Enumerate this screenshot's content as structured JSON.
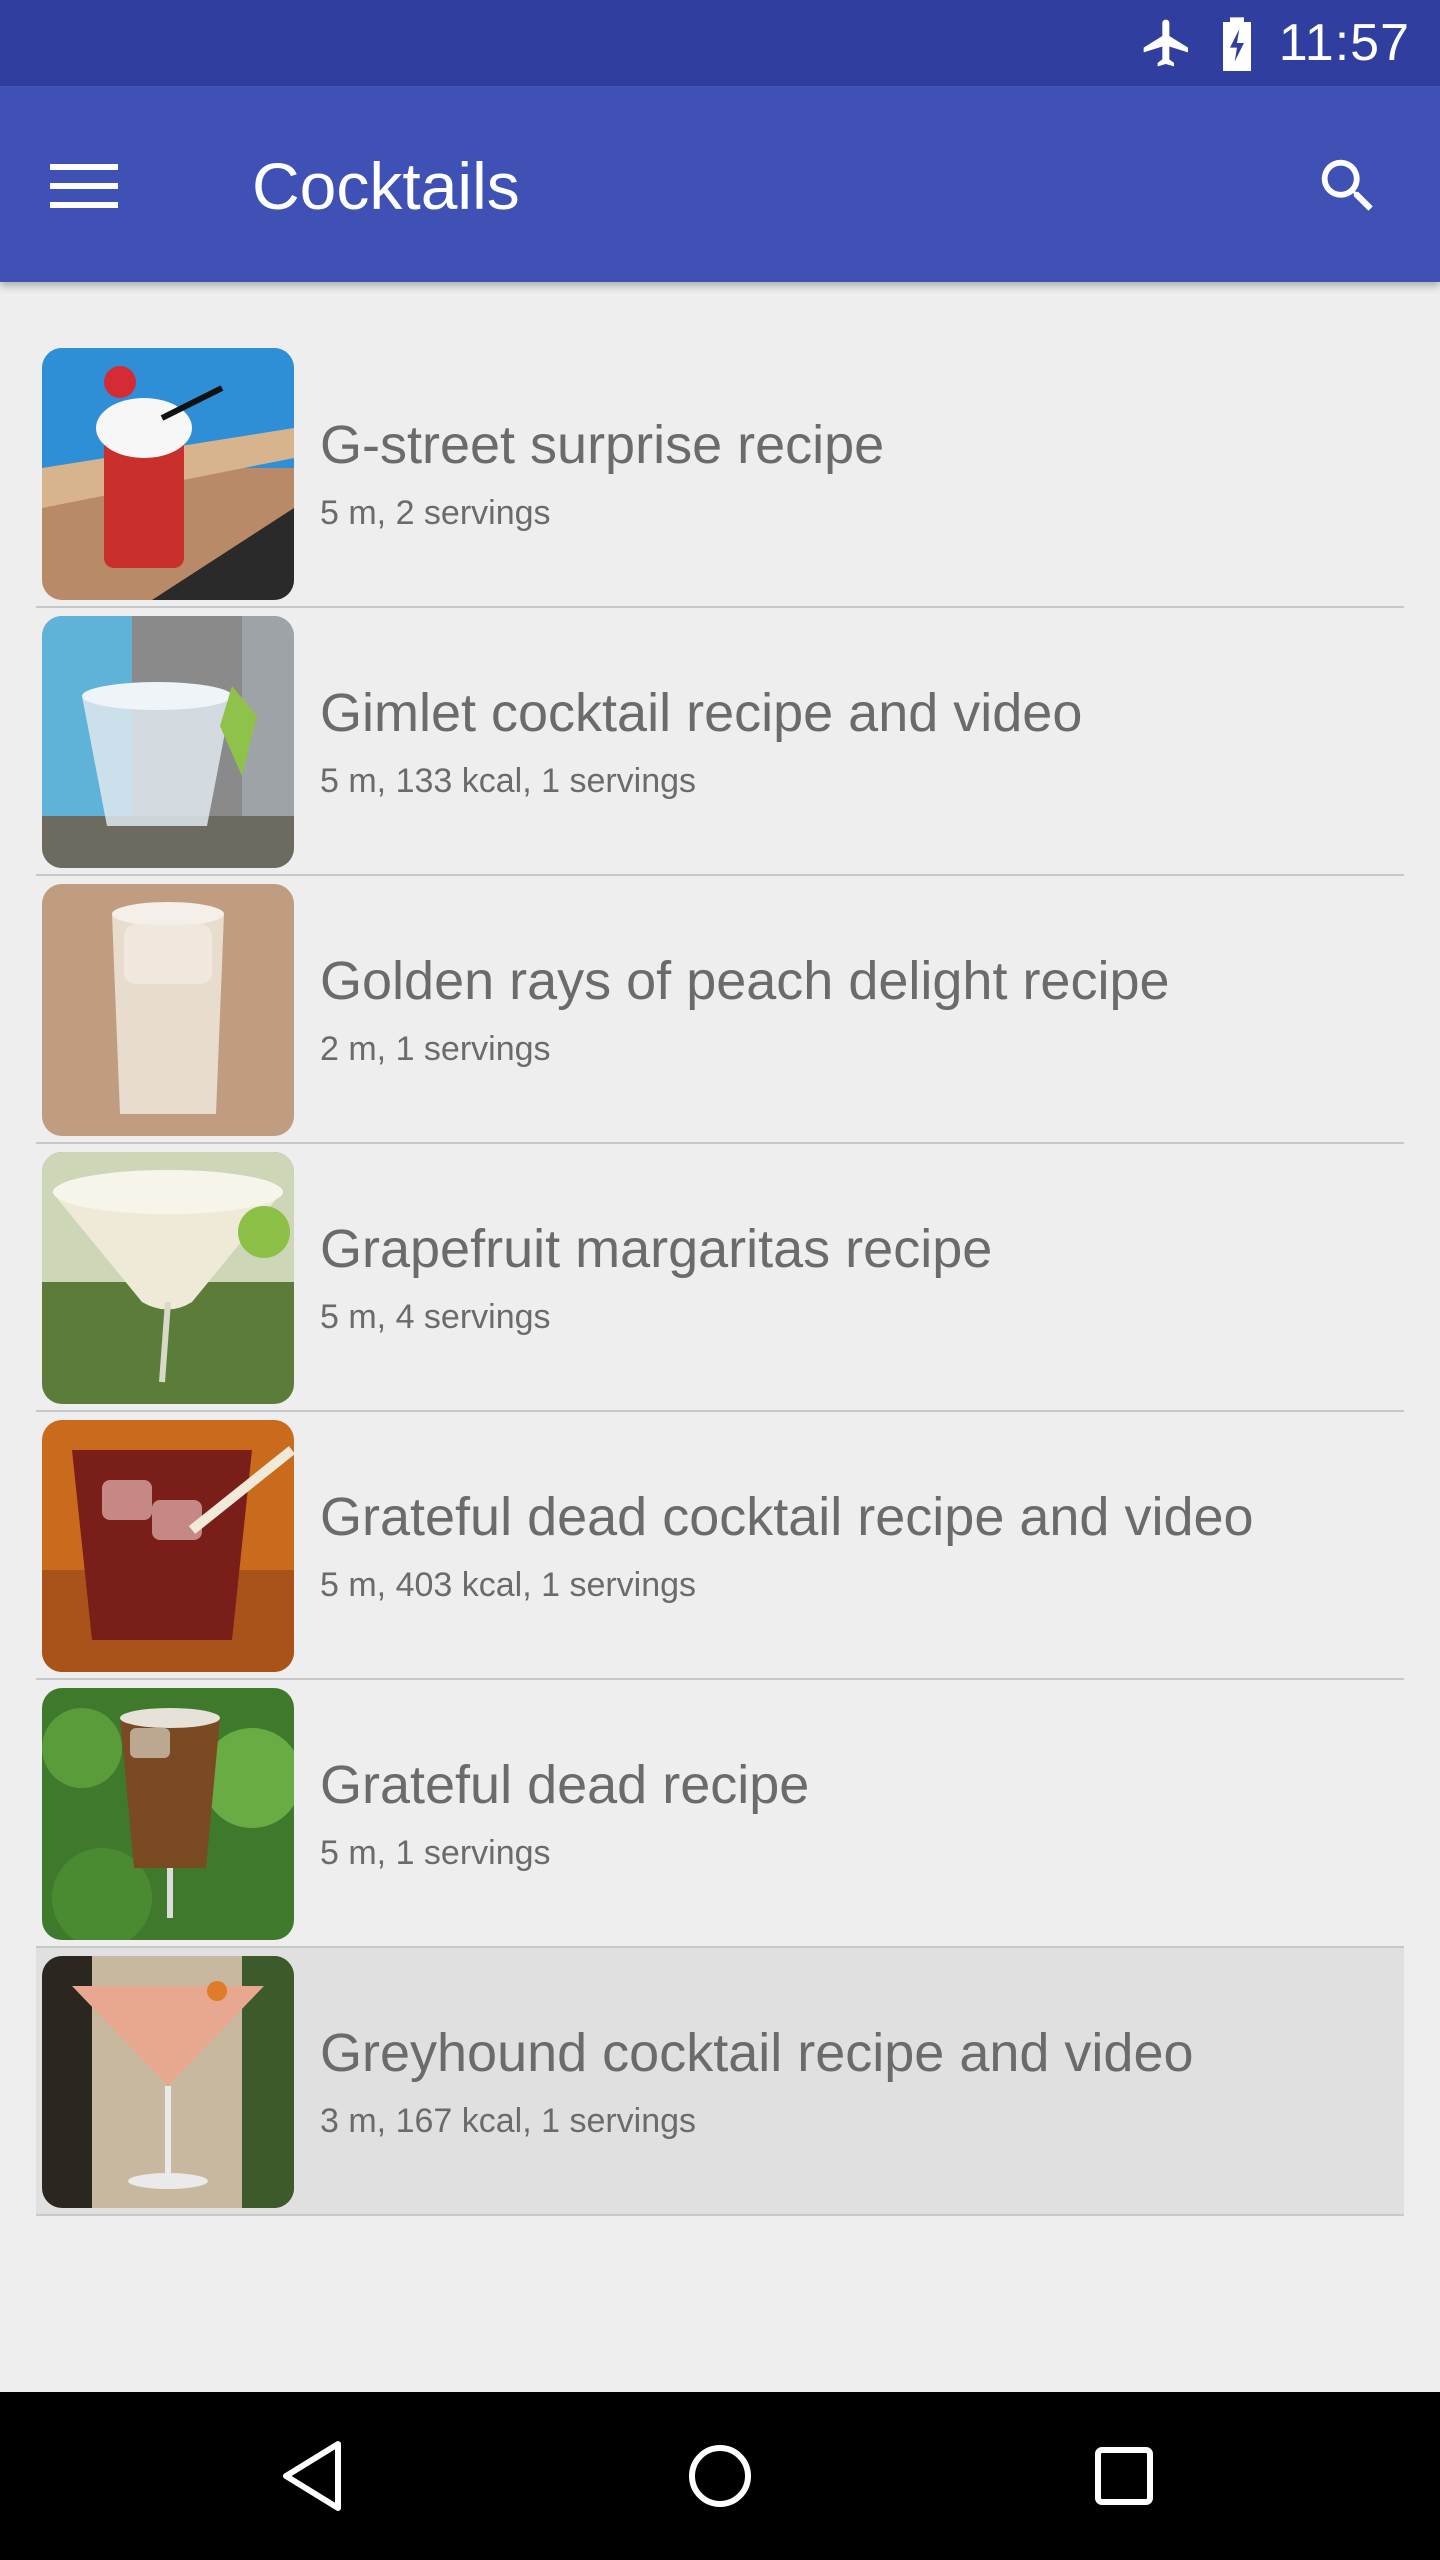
{
  "status_bar": {
    "time": "11:57",
    "icons": [
      "airplane-icon",
      "battery-charging-icon"
    ]
  },
  "app_bar": {
    "title": "Cocktails",
    "menu_icon": "hamburger-menu-icon",
    "search_icon": "search-icon",
    "color": "#3f51b5"
  },
  "recipes": [
    {
      "title": "G-street surprise recipe",
      "meta": "5 m, 2 servings"
    },
    {
      "title": "Gimlet cocktail recipe and video",
      "meta": "5 m, 133 kcal, 1 servings"
    },
    {
      "title": "Golden rays of peach delight recipe",
      "meta": "2 m, 1 servings"
    },
    {
      "title": "Grapefruit margaritas recipe",
      "meta": "5 m, 4 servings"
    },
    {
      "title": "Grateful dead cocktail recipe and video",
      "meta": "5 m, 403 kcal, 1 servings"
    },
    {
      "title": "Grateful dead recipe",
      "meta": "5 m, 1 servings"
    },
    {
      "title": "Greyhound cocktail recipe and video",
      "meta": "3 m, 167 kcal, 1 servings"
    }
  ],
  "nav_bar": {
    "icons": [
      "back-icon",
      "home-icon",
      "recents-icon"
    ]
  }
}
